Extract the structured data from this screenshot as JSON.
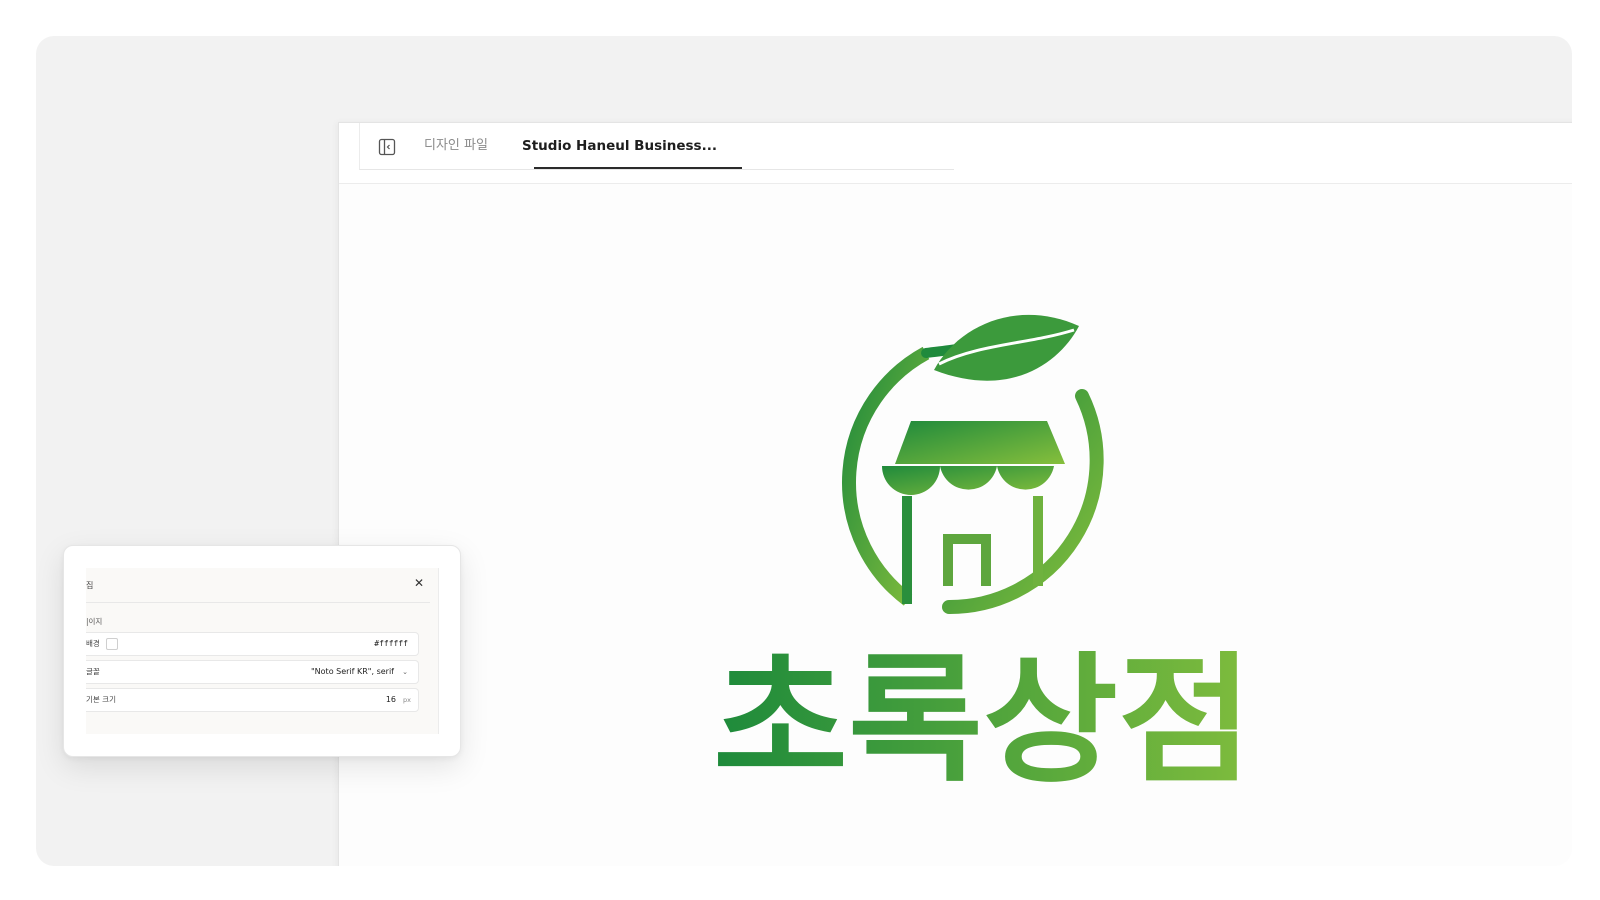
{
  "tabs": [
    {
      "label": "디자인 파일",
      "active": false
    },
    {
      "label": "Studio Haneul Business...",
      "active": true
    }
  ],
  "logo": {
    "wordmark": "초록상점",
    "colors": {
      "dark_green": "#1f8a3c",
      "light_green": "#86bf3c"
    }
  },
  "settings_panel": {
    "title": "집",
    "section": "|이지",
    "rows": [
      {
        "label": "배경",
        "value": "#ffffff",
        "control": "color"
      },
      {
        "label": "글꼴",
        "value": "\"Noto Serif KR\", serif",
        "control": "select"
      },
      {
        "label": "기본 크기",
        "value": "16",
        "unit": "px",
        "control": "number"
      }
    ],
    "close_icon": "close-icon"
  }
}
